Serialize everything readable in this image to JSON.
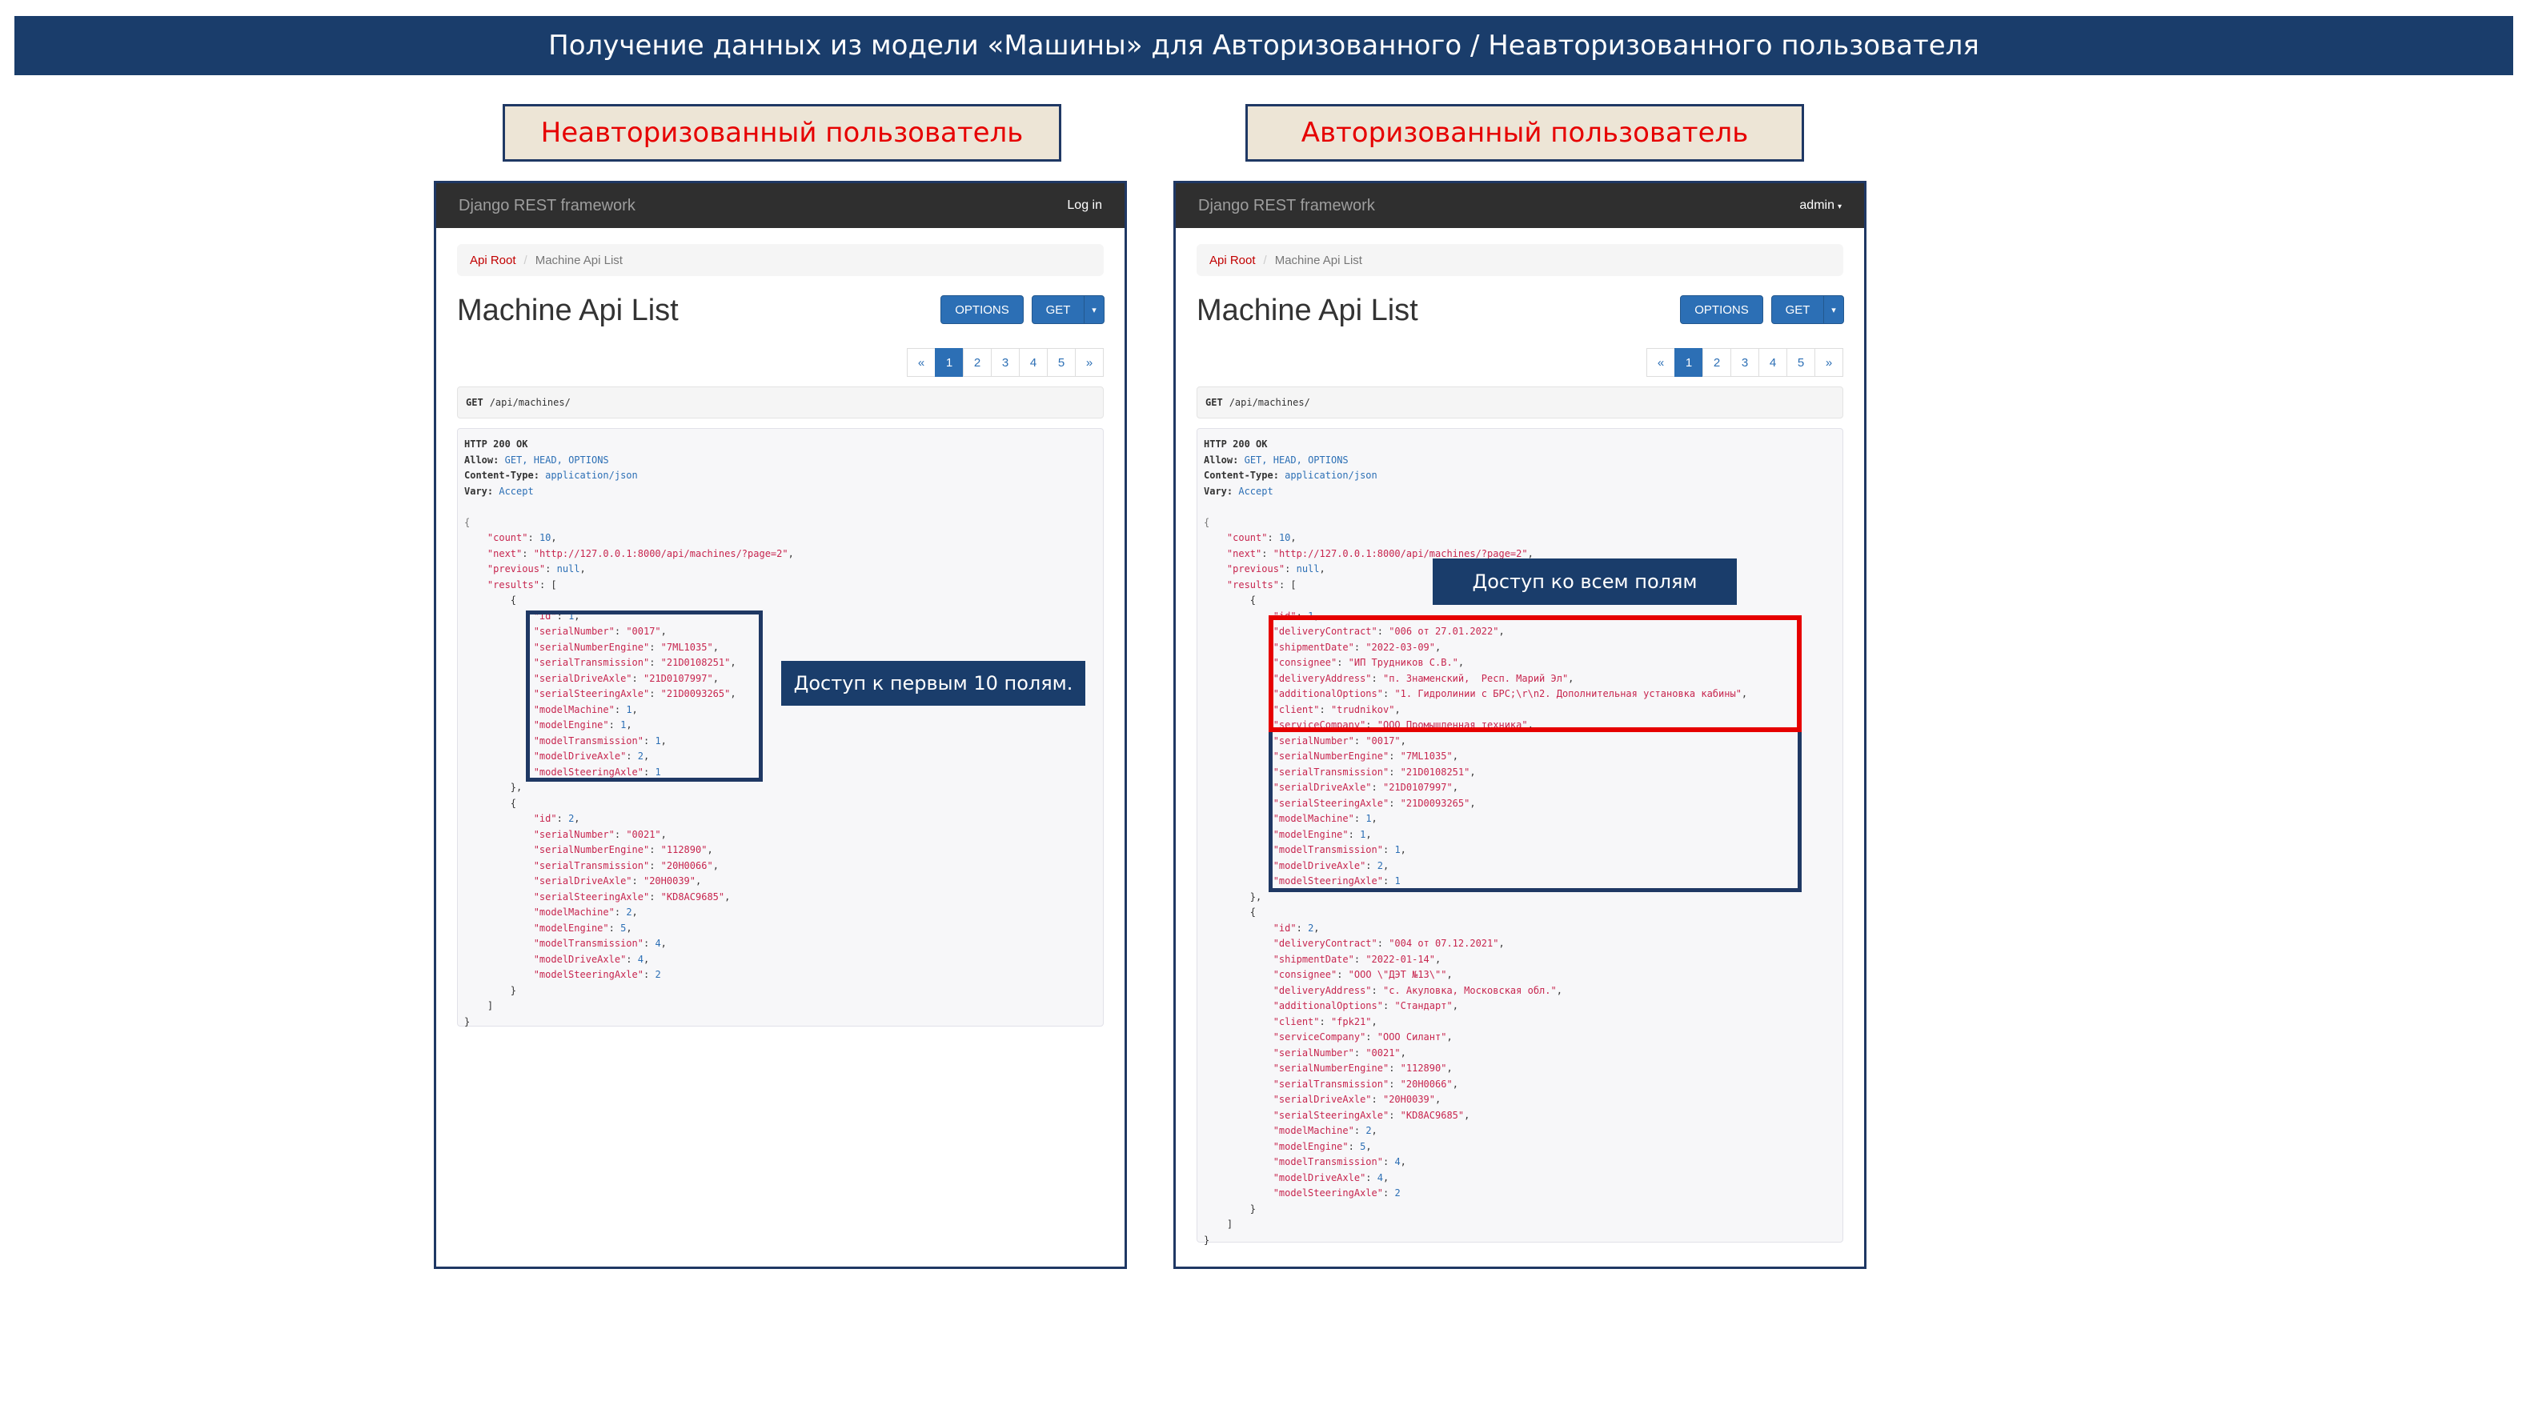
{
  "banner": "Получение данных из модели «Машины» для Авторизованного / Неавторизованного пользователя",
  "left_label": "Неавторизованный пользователь",
  "right_label": "Авторизованный пользователь",
  "colors": {
    "banner": "#1a3d6b",
    "label_text": "#e60000",
    "label_bg": "#ede5d6",
    "highlight_red": "#e60000",
    "highlight_blue": "#1f3864"
  },
  "browser": {
    "brand": "Django REST framework",
    "breadcrumb_root": "Api Root",
    "breadcrumb_sep": "/",
    "breadcrumb_current": "Machine Api List",
    "title": "Machine Api List",
    "options_button": "OPTIONS",
    "get_button": "GET",
    "get_caret": "▾",
    "pager": [
      "«",
      "1",
      "2",
      "3",
      "4",
      "5",
      "»"
    ],
    "pager_active": "1",
    "request_method": "GET",
    "request_path": "/api/machines/"
  },
  "left": {
    "nav_user": "Log in",
    "callout": "Доступ к первым 10 полям."
  },
  "right": {
    "nav_user": "admin",
    "callout": "Доступ ко всем полям"
  },
  "response_headers": {
    "status": "HTTP 200 OK",
    "allow_key": "Allow:",
    "allow_val": "GET, HEAD, OPTIONS",
    "ctype_key": "Content-Type:",
    "ctype_val": "application/json",
    "vary_key": "Vary:",
    "vary_val": "Accept"
  },
  "response_meta": {
    "count": 10,
    "next": "\"http://127.0.0.1:8000/api/machines/?page=2\"",
    "previous": "null"
  },
  "left_results": [
    [
      [
        "\"id\"",
        "1",
        "n"
      ],
      [
        "\"serialNumber\"",
        "\"0017\"",
        "s"
      ],
      [
        "\"serialNumberEngine\"",
        "\"7ML1035\"",
        "s"
      ],
      [
        "\"serialTransmission\"",
        "\"21D0108251\"",
        "s"
      ],
      [
        "\"serialDriveAxle\"",
        "\"21D0107997\"",
        "s"
      ],
      [
        "\"serialSteeringAxle\"",
        "\"21D0093265\"",
        "s"
      ],
      [
        "\"modelMachine\"",
        "1",
        "n"
      ],
      [
        "\"modelEngine\"",
        "1",
        "n"
      ],
      [
        "\"modelTransmission\"",
        "1",
        "n"
      ],
      [
        "\"modelDriveAxle\"",
        "2",
        "n"
      ],
      [
        "\"modelSteeringAxle\"",
        "1",
        "n"
      ]
    ],
    [
      [
        "\"id\"",
        "2",
        "n"
      ],
      [
        "\"serialNumber\"",
        "\"0021\"",
        "s"
      ],
      [
        "\"serialNumberEngine\"",
        "\"112890\"",
        "s"
      ],
      [
        "\"serialTransmission\"",
        "\"20H0066\"",
        "s"
      ],
      [
        "\"serialDriveAxle\"",
        "\"20H0039\"",
        "s"
      ],
      [
        "\"serialSteeringAxle\"",
        "\"KD8AC9685\"",
        "s"
      ],
      [
        "\"modelMachine\"",
        "2",
        "n"
      ],
      [
        "\"modelEngine\"",
        "5",
        "n"
      ],
      [
        "\"modelTransmission\"",
        "4",
        "n"
      ],
      [
        "\"modelDriveAxle\"",
        "4",
        "n"
      ],
      [
        "\"modelSteeringAxle\"",
        "2",
        "n"
      ]
    ]
  ],
  "right_results": [
    [
      [
        "\"id\"",
        "1",
        "n"
      ],
      [
        "\"deliveryContract\"",
        "\"006 от 27.01.2022\"",
        "s"
      ],
      [
        "\"shipmentDate\"",
        "\"2022-03-09\"",
        "s"
      ],
      [
        "\"consignee\"",
        "\"ИП Трудников С.В.\"",
        "s"
      ],
      [
        "\"deliveryAddress\"",
        "\"п. Знаменский,  Респ. Марий Эл\"",
        "s"
      ],
      [
        "\"additionalOptions\"",
        "\"1. Гидролинии с БРС;\\r\\n2. Дополнительная установка кабины\"",
        "s"
      ],
      [
        "\"client\"",
        "\"trudnikov\"",
        "s"
      ],
      [
        "\"serviceCompany\"",
        "\"ООО Промышленная техника\"",
        "s"
      ],
      [
        "\"serialNumber\"",
        "\"0017\"",
        "s"
      ],
      [
        "\"serialNumberEngine\"",
        "\"7ML1035\"",
        "s"
      ],
      [
        "\"serialTransmission\"",
        "\"21D0108251\"",
        "s"
      ],
      [
        "\"serialDriveAxle\"",
        "\"21D0107997\"",
        "s"
      ],
      [
        "\"serialSteeringAxle\"",
        "\"21D0093265\"",
        "s"
      ],
      [
        "\"modelMachine\"",
        "1",
        "n"
      ],
      [
        "\"modelEngine\"",
        "1",
        "n"
      ],
      [
        "\"modelTransmission\"",
        "1",
        "n"
      ],
      [
        "\"modelDriveAxle\"",
        "2",
        "n"
      ],
      [
        "\"modelSteeringAxle\"",
        "1",
        "n"
      ]
    ],
    [
      [
        "\"id\"",
        "2",
        "n"
      ],
      [
        "\"deliveryContract\"",
        "\"004 от 07.12.2021\"",
        "s"
      ],
      [
        "\"shipmentDate\"",
        "\"2022-01-14\"",
        "s"
      ],
      [
        "\"consignee\"",
        "\"ООО \\\"ДЭТ №13\\\"\"",
        "s"
      ],
      [
        "\"deliveryAddress\"",
        "\"с. Акуловка, Московская обл.\"",
        "s"
      ],
      [
        "\"additionalOptions\"",
        "\"Стандарт\"",
        "s"
      ],
      [
        "\"client\"",
        "\"fpk21\"",
        "s"
      ],
      [
        "\"serviceCompany\"",
        "\"ООО Силант\"",
        "s"
      ],
      [
        "\"serialNumber\"",
        "\"0021\"",
        "s"
      ],
      [
        "\"serialNumberEngine\"",
        "\"112890\"",
        "s"
      ],
      [
        "\"serialTransmission\"",
        "\"20H0066\"",
        "s"
      ],
      [
        "\"serialDriveAxle\"",
        "\"20H0039\"",
        "s"
      ],
      [
        "\"serialSteeringAxle\"",
        "\"KD8AC9685\"",
        "s"
      ],
      [
        "\"modelMachine\"",
        "2",
        "n"
      ],
      [
        "\"modelEngine\"",
        "5",
        "n"
      ],
      [
        "\"modelTransmission\"",
        "4",
        "n"
      ],
      [
        "\"modelDriveAxle\"",
        "4",
        "n"
      ],
      [
        "\"modelSteeringAxle\"",
        "2",
        "n"
      ]
    ]
  ]
}
